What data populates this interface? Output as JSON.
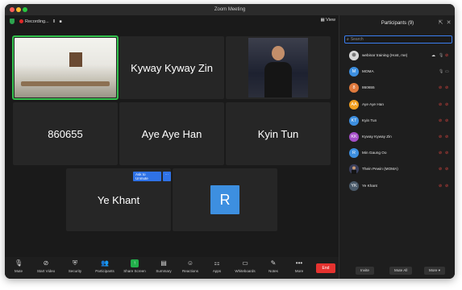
{
  "window": {
    "title": "Zoom Meeting"
  },
  "meeting_bar": {
    "recording_label": "Recording...",
    "pause_glyph": "II",
    "stop_glyph": "■",
    "view_label": "View"
  },
  "tiles": [
    {
      "name": "",
      "type": "video-room",
      "active": true
    },
    {
      "name": "Kyway Kyway Zin",
      "type": "name"
    },
    {
      "name": "",
      "type": "video-person"
    },
    {
      "name": "860655",
      "type": "name"
    },
    {
      "name": "Aye Aye Han",
      "type": "name"
    },
    {
      "name": "Kyin Tun",
      "type": "name"
    },
    {
      "name": "Ye Khant",
      "type": "name",
      "unmute_label": "Ask to Unmute",
      "more_label": "···"
    },
    {
      "name": "",
      "type": "avatar",
      "avatar_letter": "R",
      "avatar_color": "#3d8fe0"
    }
  ],
  "toolbar": {
    "items": [
      {
        "label": "Mute",
        "icon": "mic-icon"
      },
      {
        "label": "Start Video",
        "icon": "video-off-icon"
      },
      {
        "label": "Security",
        "icon": "shield-icon"
      },
      {
        "label": "Participants",
        "icon": "participants-icon",
        "count": "9"
      },
      {
        "label": "Share Screen",
        "icon": "share-screen-icon"
      },
      {
        "label": "Summary",
        "icon": "summary-icon"
      },
      {
        "label": "Reactions",
        "icon": "reactions-icon"
      },
      {
        "label": "Apps",
        "icon": "apps-icon"
      },
      {
        "label": "Whiteboards",
        "icon": "whiteboard-icon"
      },
      {
        "label": "Notes",
        "icon": "notes-icon"
      },
      {
        "label": "More",
        "icon": "more-icon"
      }
    ],
    "end_label": "End",
    "end_color": "#e5322f"
  },
  "participants_panel": {
    "title": "Participants (9)",
    "search_placeholder": "Search",
    "participants": [
      {
        "name": "webinar training (Host, me)",
        "initials": "",
        "color": "#7a7a7a",
        "mic_muted": false,
        "cam_off": true
      },
      {
        "name": "MOMA",
        "initials": "M",
        "color": "#3d8fe0",
        "mic_muted": false,
        "cam_off": false
      },
      {
        "name": "860655",
        "initials": "8",
        "color": "#e07a3d",
        "mic_muted": true,
        "cam_off": true
      },
      {
        "name": "Aye Aye Han",
        "initials": "AA",
        "color": "#f0a020",
        "mic_muted": true,
        "cam_off": true
      },
      {
        "name": "Kyin Tun",
        "initials": "KT",
        "color": "#3d8fe0",
        "mic_muted": true,
        "cam_off": true
      },
      {
        "name": "Kyway Kyway Zin",
        "initials": "KK",
        "color": "#a64fc9",
        "mic_muted": true,
        "cam_off": true
      },
      {
        "name": "Min Gaung Oo",
        "initials": "R",
        "color": "#3d8fe0",
        "mic_muted": true,
        "cam_off": true
      },
      {
        "name": "Thein Pewin (MOMA)",
        "initials": "",
        "color": "#3a3f5c",
        "mic_muted": true,
        "cam_off": true
      },
      {
        "name": "Ye Khant",
        "initials": "YK",
        "color": "#4a5a6a",
        "mic_muted": true,
        "cam_off": true
      }
    ],
    "invite_label": "Invite",
    "mute_all_label": "Mute All",
    "more_label": "More ▾"
  }
}
